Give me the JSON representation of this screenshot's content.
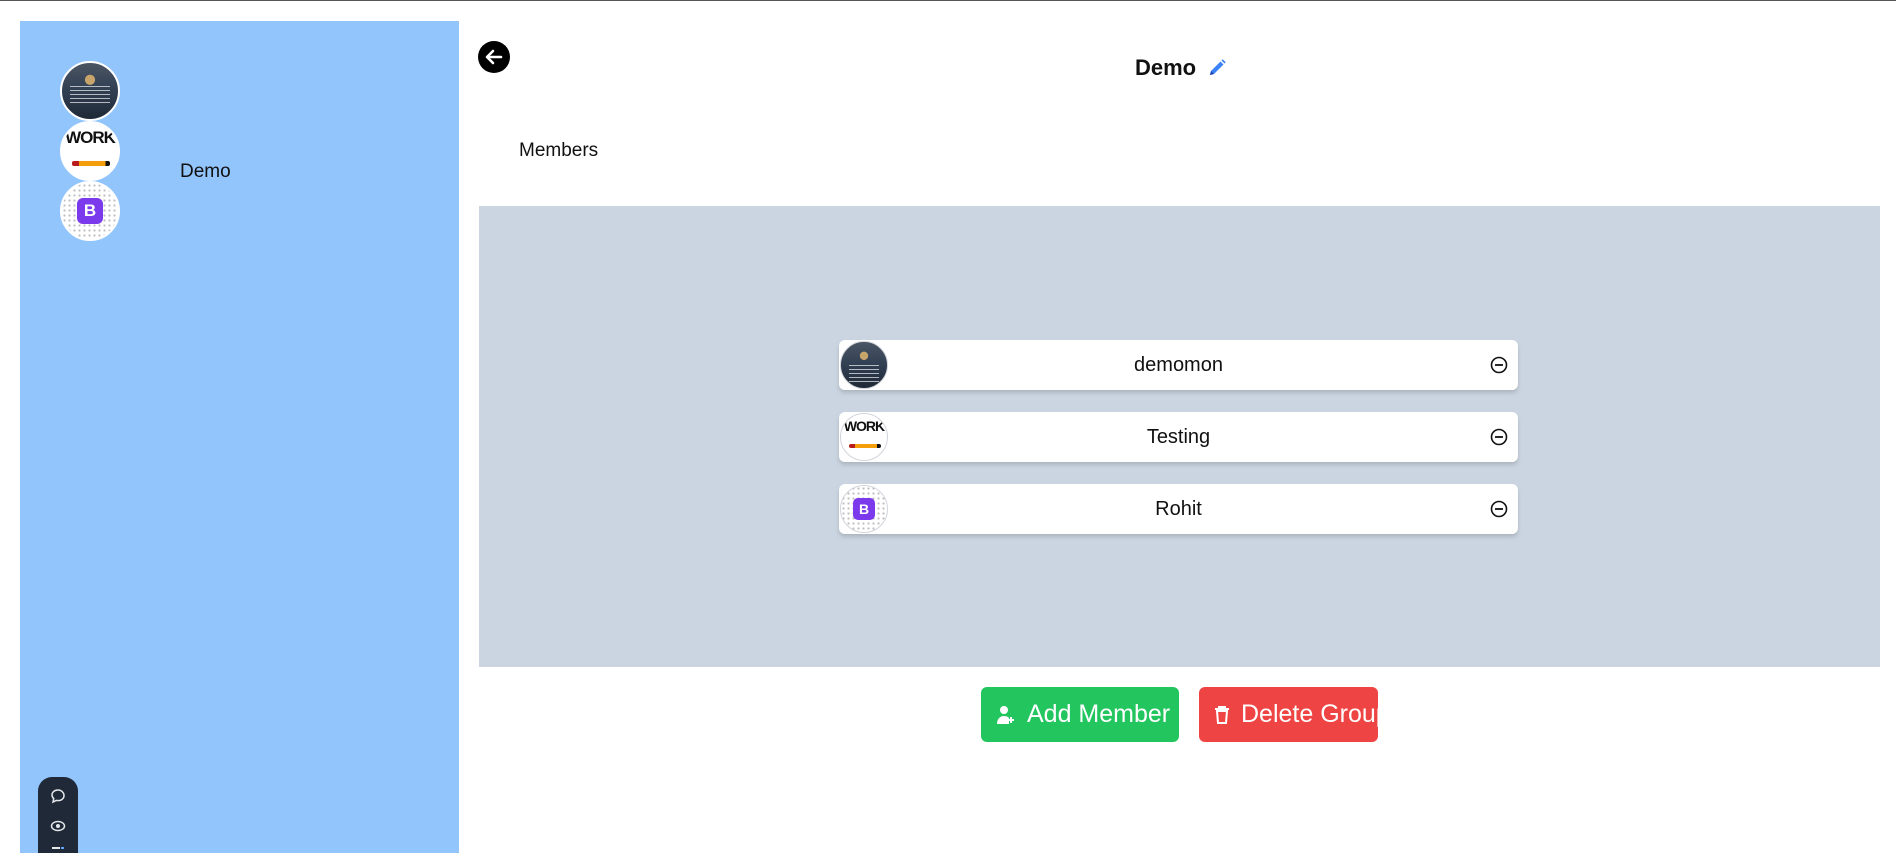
{
  "sidebar": {
    "group": {
      "name": "Demo",
      "avatars": [
        "code-screen-photo",
        "work-logo",
        "bootstrap-logo"
      ]
    },
    "dock_icons": [
      "chat-icon",
      "eye-icon",
      "menu-icon"
    ]
  },
  "header": {
    "title": "Demo",
    "back_icon": "arrow-left-icon",
    "edit_icon": "pencil-icon"
  },
  "tabs": {
    "members_label": "Members"
  },
  "members": [
    {
      "name": "demomon",
      "avatar": "code-screen-photo"
    },
    {
      "name": "Testing",
      "avatar": "work-logo"
    },
    {
      "name": "Rohit",
      "avatar": "bootstrap-logo"
    }
  ],
  "logos": {
    "work_text": "WORK",
    "b_text": "B"
  },
  "actions": {
    "add_member_label": "Add Member",
    "delete_group_label": "Delete Group"
  },
  "colors": {
    "sidebar_bg": "#93c5fd",
    "panel_bg": "#cbd5e1",
    "add_button": "#22c55e",
    "delete_button": "#ef4444",
    "edit_icon": "#3b82f6"
  }
}
